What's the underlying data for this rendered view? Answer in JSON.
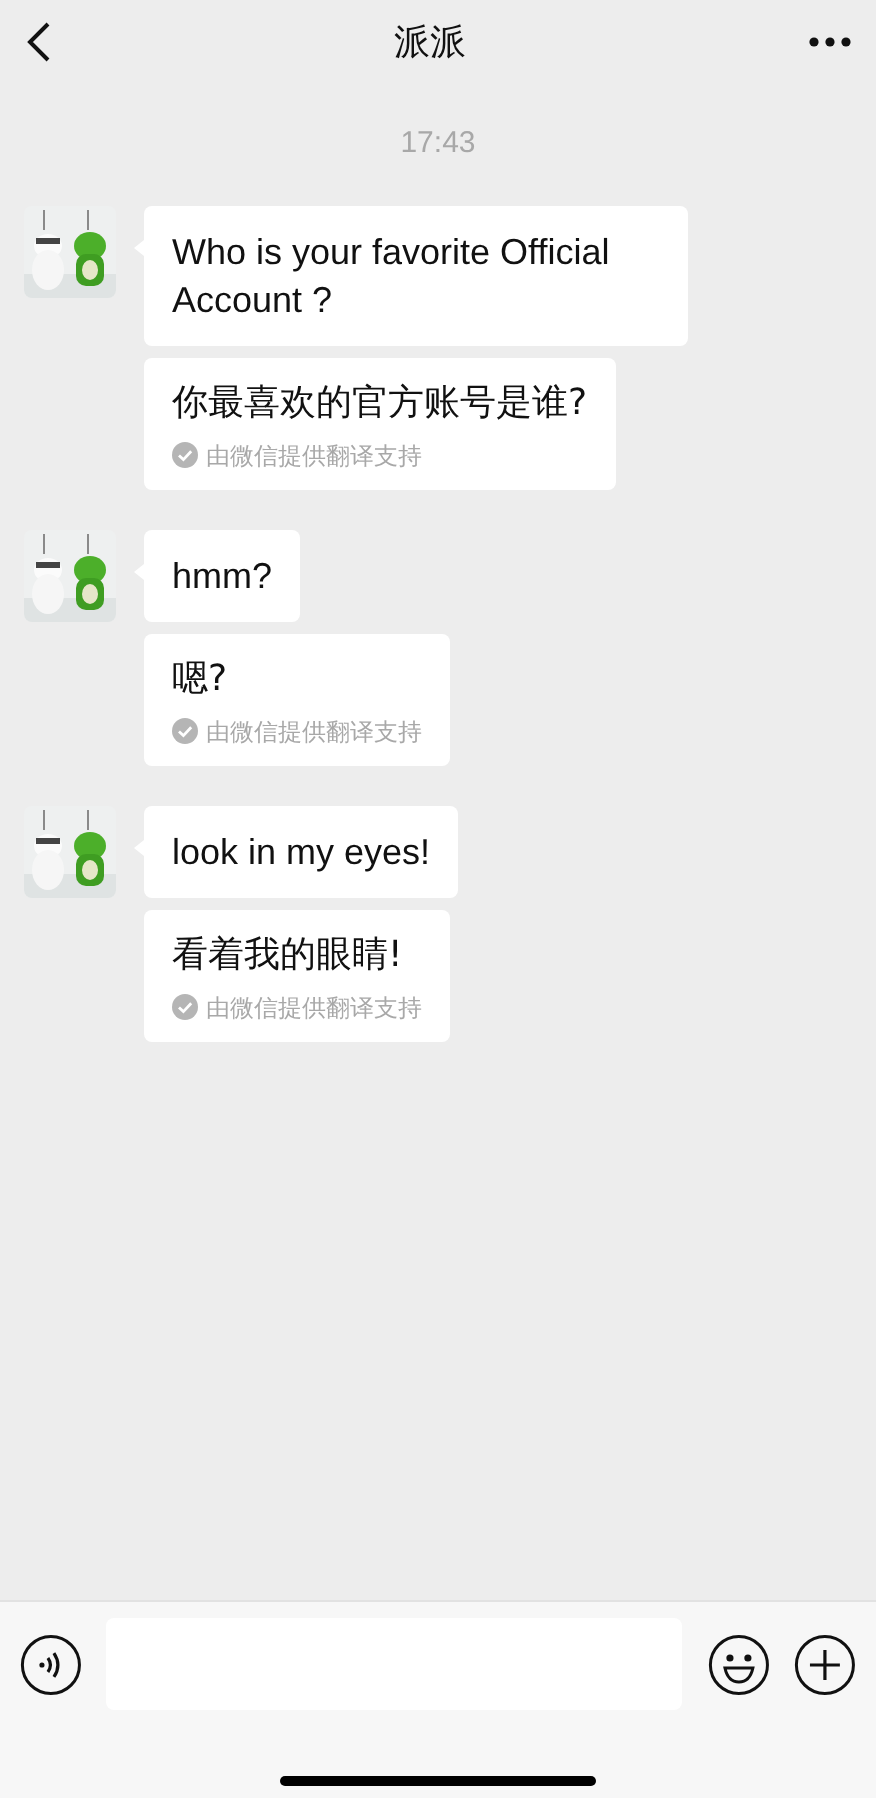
{
  "header": {
    "title": "派派"
  },
  "timestamp": "17:43",
  "messages": [
    {
      "text": "Who is your favorite Official Account ?",
      "translation": "你最喜欢的官方账号是谁?",
      "translation_note": "由微信提供翻译支持"
    },
    {
      "text": "hmm?",
      "translation": "嗯?",
      "translation_note": "由微信提供翻译支持"
    },
    {
      "text": "look in my eyes!",
      "translation": "看着我的眼睛!",
      "translation_note": "由微信提供翻译支持"
    }
  ]
}
